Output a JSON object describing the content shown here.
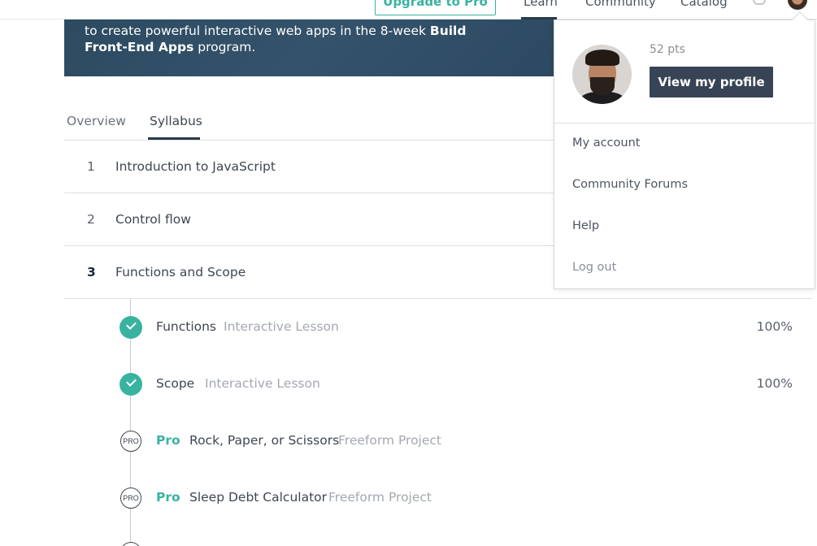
{
  "topnav": {
    "upgrade_label": "Upgrade to Pro",
    "links": [
      "Learn",
      "Community",
      "Catalog"
    ]
  },
  "banner": {
    "line1": "to create powerful interactive web apps in the 8-week ",
    "bold1": "Build",
    "bold2": "Front-End Apps",
    "line2": " program."
  },
  "tabs": [
    "Overview",
    "Syllabus"
  ],
  "units": [
    {
      "num": "1",
      "title": "Introduction to JavaScript"
    },
    {
      "num": "2",
      "title": "Control flow"
    },
    {
      "num": "3",
      "title": "Functions and Scope"
    }
  ],
  "lessons": [
    {
      "name": "Functions",
      "kind": "Interactive Lesson",
      "progress": "100%",
      "status": "complete"
    },
    {
      "name": "Scope",
      "kind": "Interactive Lesson",
      "progress": "100%",
      "status": "complete"
    },
    {
      "pro": "Pro",
      "badge": "PRO",
      "name": "Rock, Paper, or Scissors",
      "kind": "Freeform Project",
      "status": "pro"
    },
    {
      "pro": "Pro",
      "badge": "PRO",
      "name": "Sleep Debt Calculator",
      "kind": "Freeform Project",
      "status": "pro"
    }
  ],
  "dropdown": {
    "points": "52 pts",
    "view_profile_label": "View my profile",
    "items": [
      "My account",
      "Community Forums",
      "Help",
      "Log out"
    ]
  },
  "colors": {
    "accent": "#39b3a0",
    "banner": "#2e4c63",
    "button_dark": "#374455"
  },
  "icons": [
    "bell-icon",
    "avatar",
    "check-icon",
    "pro-badge-icon"
  ]
}
